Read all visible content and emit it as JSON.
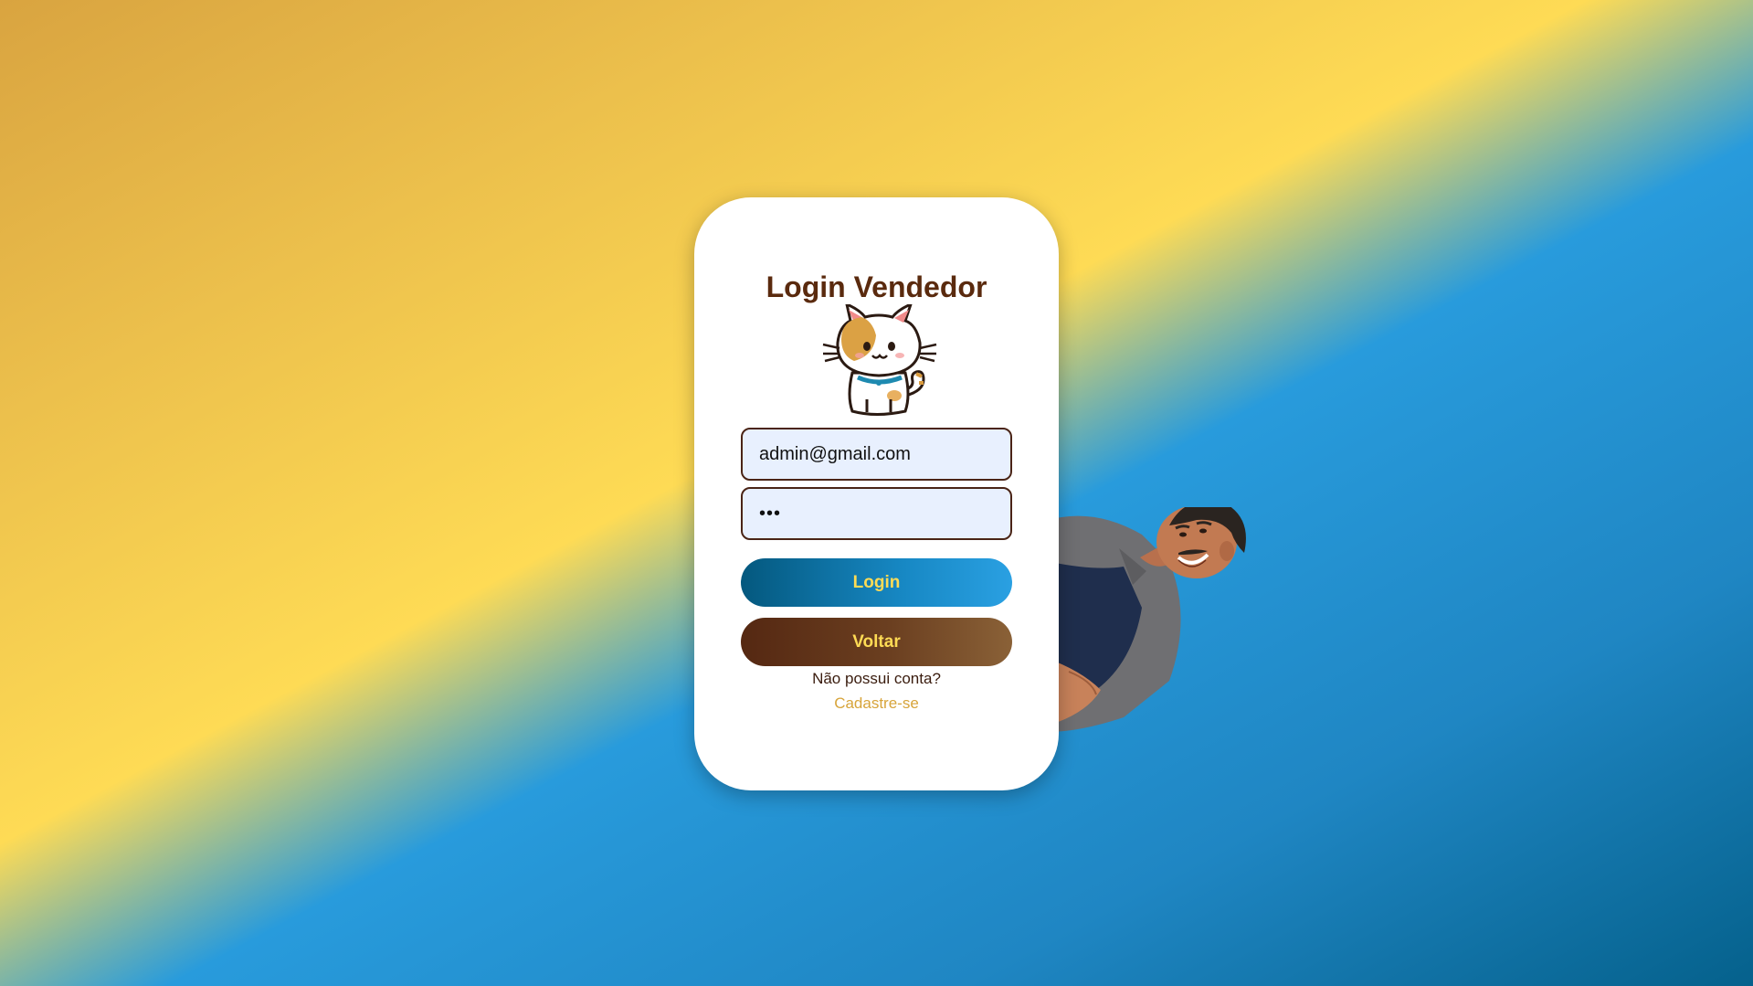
{
  "login": {
    "title": "Login Vendedor",
    "email_value": "admin@gmail.com",
    "password_value": "•••",
    "login_button": "Login",
    "back_button": "Voltar",
    "no_account_text": "Não possui conta?",
    "signup_link": "Cadastre-se"
  },
  "icons": {
    "mascot": "cat-mascot-icon",
    "seller": "seller-illustration"
  },
  "colors": {
    "title": "#5a2a0e",
    "accent_yellow": "#fedb55",
    "accent_blue": "#1f86c3",
    "brown": "#552812",
    "link": "#d7a43a"
  }
}
